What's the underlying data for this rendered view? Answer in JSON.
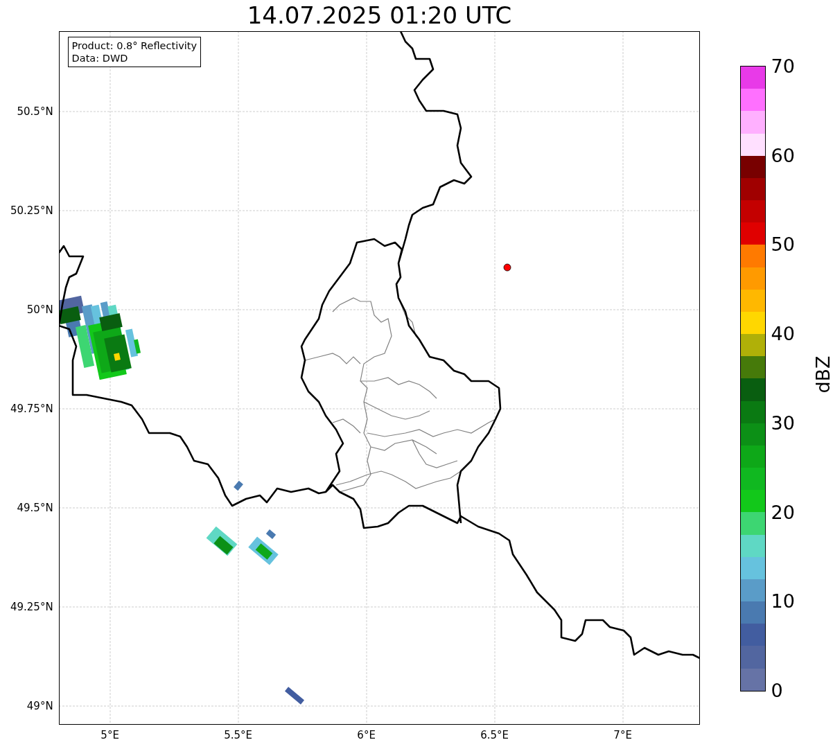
{
  "title": "14.07.2025 01:20 UTC",
  "info_box": [
    "Product: 0.8° Reflectivity",
    "Data: DWD"
  ],
  "map": {
    "yticks": [
      "50.5°N",
      "50.25°N",
      "50°N",
      "49.75°N",
      "49.5°N",
      "49.25°N",
      "49°N"
    ],
    "xticks": [
      "5°E",
      "5.5°E",
      "6°E",
      "6.5°E",
      "7°E"
    ]
  },
  "colorbar": {
    "label": "dBZ",
    "ticks": [
      "70",
      "60",
      "50",
      "40",
      "30",
      "20",
      "10",
      "0"
    ],
    "segments": [
      {
        "color": "#6673a6"
      },
      {
        "color": "#5266a0"
      },
      {
        "color": "#425da0"
      },
      {
        "color": "#4a7ab0"
      },
      {
        "color": "#5a9cc8"
      },
      {
        "color": "#66c2de"
      },
      {
        "color": "#5fd8c4"
      },
      {
        "color": "#3dd672"
      },
      {
        "color": "#12c81a"
      },
      {
        "color": "#10b820"
      },
      {
        "color": "#0ea818"
      },
      {
        "color": "#0c9016"
      },
      {
        "color": "#0a7a12"
      },
      {
        "color": "#095e10"
      },
      {
        "color": "#467a0a"
      },
      {
        "color": "#b0b008"
      },
      {
        "color": "#ffd700"
      },
      {
        "color": "#ffb800"
      },
      {
        "color": "#ff9a00"
      },
      {
        "color": "#ff7a00"
      },
      {
        "color": "#e00000"
      },
      {
        "color": "#c40000"
      },
      {
        "color": "#a00000"
      },
      {
        "color": "#780000"
      },
      {
        "color": "#ffe0ff"
      },
      {
        "color": "#ffb0ff"
      },
      {
        "color": "#ff70ff"
      },
      {
        "color": "#e83ae8"
      }
    ]
  }
}
